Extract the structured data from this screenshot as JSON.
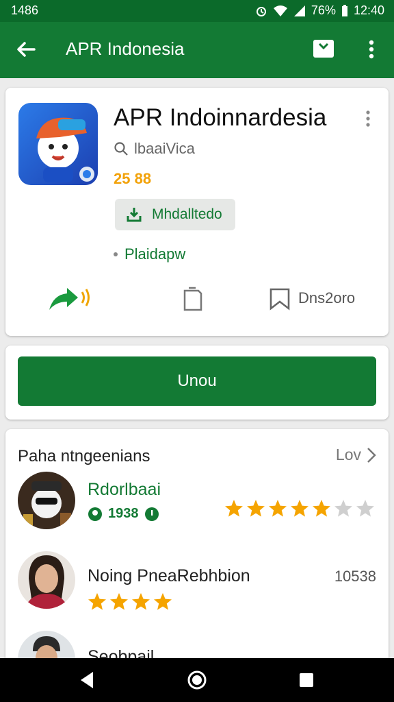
{
  "status_bar": {
    "time_left": "1486",
    "battery_percent": "76%",
    "clock": "12:40"
  },
  "app_bar": {
    "title": "APR Indonesia"
  },
  "app": {
    "name": "APR Indoinnardesia",
    "developer": "lbaaiVica",
    "rating_text": "25 88",
    "badge_label": "Mhdalltedo",
    "category": "Plaidapw"
  },
  "actions": {
    "save_label": "Dns2oro"
  },
  "install_label": "Unou",
  "reviews": {
    "title": "Paha ntngeenians",
    "more_label": "Lov",
    "items": [
      {
        "name": "Rdorlbaai",
        "meta": "1938",
        "stars": 5,
        "stars_total": 7,
        "count": ""
      },
      {
        "name": "Noing PneaRebhbion",
        "meta": "",
        "stars": 4,
        "stars_total": 4,
        "count": "10538"
      },
      {
        "name": "Seobpail",
        "meta": "",
        "stars": 0,
        "stars_total": 0,
        "count": ""
      }
    ]
  },
  "colors": {
    "primary": "#137a34",
    "status": "#0b6a2a",
    "star": "#f5a400",
    "star_empty": "#cfcfcf"
  },
  "icons": [
    "back-arrow-icon",
    "bookmark-box-icon",
    "more-vert-icon",
    "search-icon",
    "download-icon",
    "share-icon",
    "copy-icon",
    "bookmark-icon",
    "chevron-right-icon",
    "star-icon",
    "back-nav-icon",
    "home-nav-icon",
    "recents-nav-icon"
  ]
}
